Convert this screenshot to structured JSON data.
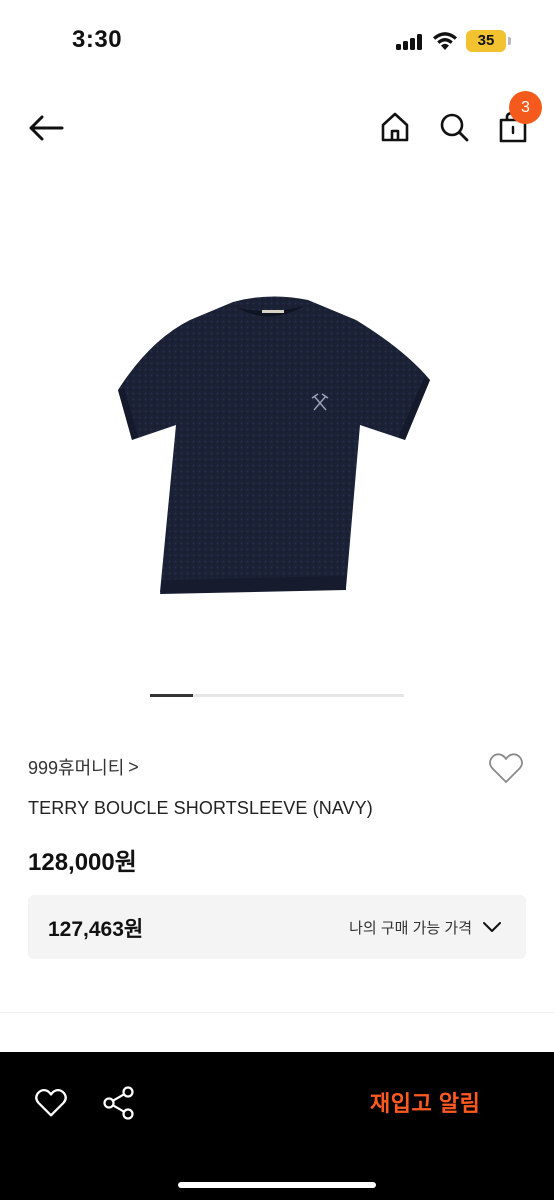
{
  "status_bar": {
    "time": "3:30",
    "battery": "35",
    "icons": [
      "signal-icon",
      "wifi-icon",
      "battery-icon"
    ]
  },
  "header": {
    "icons": [
      "back-arrow-icon",
      "home-icon",
      "search-icon",
      "shopping-bag-icon"
    ],
    "cart_count": "3"
  },
  "carousel": {
    "current_fraction": 0.17
  },
  "product": {
    "brand": "999휴머니티",
    "brand_chevron": ">",
    "title": "TERRY BOUCLE SHORTSLEEVE (NAVY)",
    "price": "128,000원",
    "my_price": "127,463원",
    "my_price_label": "나의 구매 가능 가격"
  },
  "bottom_bar": {
    "restock_label": "재입고 알림",
    "icons": [
      "heart-icon",
      "share-icon"
    ]
  },
  "colors": {
    "accent": "#ff5a1f",
    "badge": "#f45a1b",
    "garment": "#1c2236",
    "bottom_bar_bg": "#000000",
    "price_box_bg": "#f4f4f4"
  }
}
